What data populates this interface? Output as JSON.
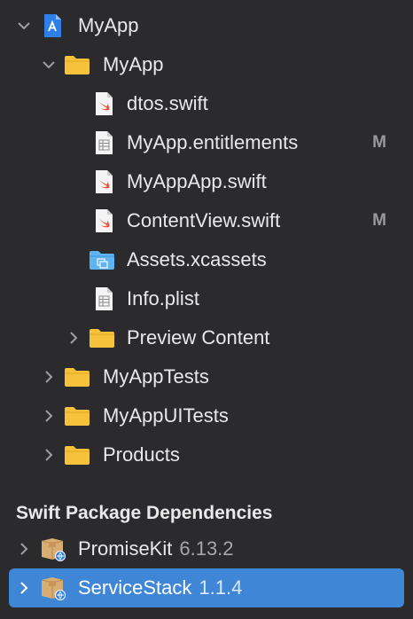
{
  "navigator": {
    "project": {
      "label": "MyApp"
    },
    "group": {
      "label": "MyApp"
    },
    "files": [
      {
        "label": "dtos.swift",
        "icon": "swift-file-icon",
        "status": ""
      },
      {
        "label": "MyApp.entitlements",
        "icon": "entitlements-file-icon",
        "status": "M"
      },
      {
        "label": "MyAppApp.swift",
        "icon": "swift-file-icon",
        "status": ""
      },
      {
        "label": "ContentView.swift",
        "icon": "swift-file-icon",
        "status": "M"
      },
      {
        "label": "Assets.xcassets",
        "icon": "asset-catalog-folder-icon",
        "status": ""
      },
      {
        "label": "Info.plist",
        "icon": "plist-file-icon",
        "status": ""
      },
      {
        "label": "Preview Content",
        "icon": "folder-icon",
        "status": ""
      }
    ],
    "groups": [
      {
        "label": "MyAppTests"
      },
      {
        "label": "MyAppUITests"
      },
      {
        "label": "Products"
      }
    ]
  },
  "packages": {
    "header": "Swift Package Dependencies",
    "items": [
      {
        "name": "PromiseKit",
        "version": "6.13.2"
      },
      {
        "name": "ServiceStack",
        "version": "1.1.4"
      }
    ]
  },
  "colors": {
    "background": "#2b2a2d",
    "selection": "#3f86d6",
    "folder": "#f6c23b",
    "swift": "#f05138"
  }
}
